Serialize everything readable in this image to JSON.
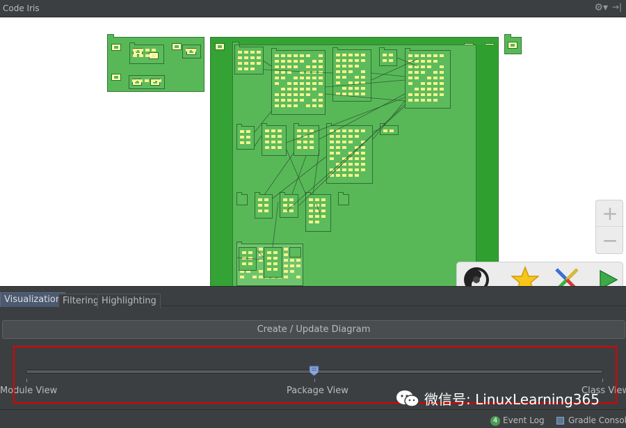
{
  "window": {
    "title": "Code Iris"
  },
  "header": {
    "settings_icon": "gear-icon",
    "pin_icon": "pin-icon"
  },
  "diagram": {
    "zoom_in_label": "+",
    "zoom_out_label": "−",
    "tools": [
      "jsonviewer-swirl-icon",
      "star-icon",
      "cross-arrows-icon",
      "play-icon"
    ]
  },
  "tabs": [
    {
      "label": "Visualization",
      "active": true
    },
    {
      "label": "Filtering",
      "active": false
    },
    {
      "label": "Highlighting",
      "active": false
    }
  ],
  "actions": {
    "create_update": "Create / Update Diagram"
  },
  "slider": {
    "labels": [
      "Module View",
      "Package View",
      "Class View"
    ],
    "value": 0.5
  },
  "watermark": {
    "text": "微信号: LinuxLearning365"
  },
  "status": {
    "event_log_count": "4",
    "event_log": "Event Log",
    "gradle_console": "Gradle Console"
  },
  "colors": {
    "package_green": "#58b858",
    "class_chip": "#f6f38b",
    "highlight_border": "#e00000",
    "active_tab": "#4b5a70"
  }
}
